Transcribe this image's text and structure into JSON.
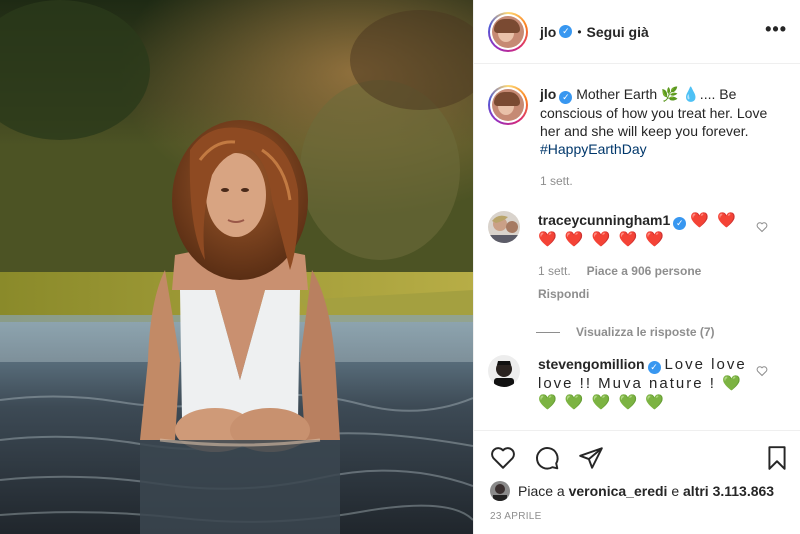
{
  "post": {
    "author": "jlo",
    "follow_status": "Segui già",
    "more_icon": "•••",
    "caption_text": "Mother Earth 🌿 💧.... Be conscious of how you treat her. Love her and she will keep you forever.",
    "caption_hashtag": "#HappyEarthDay",
    "caption_age": "1 sett.",
    "likes_prefix": "Piace a",
    "likes_user": "veronica_eredi",
    "likes_suffix": "e",
    "likes_others": "altri 3.113.863",
    "date": "23 APRILE"
  },
  "comments": [
    {
      "user": "traceycunningham1",
      "text": "❤️ ❤️ ❤️ ❤️ ❤️ ❤️ ❤️",
      "age": "1 sett.",
      "likes": "Piace a 906 persone",
      "reply": "Rispondi",
      "view_replies": "Visualizza le risposte (7)"
    },
    {
      "user": "stevengomillion",
      "text": "Love love love !! Muva nature ! 💚 💚 💚 💚 💚 💚"
    }
  ],
  "icons": {
    "like": "heart-icon",
    "comment": "comment-icon",
    "share": "share-icon",
    "save": "bookmark-icon",
    "verified": "verified-badge-icon"
  },
  "colors": {
    "link": "#00376b",
    "muted": "#8e8e8e",
    "verified": "#3897f0",
    "border": "#efefef"
  }
}
